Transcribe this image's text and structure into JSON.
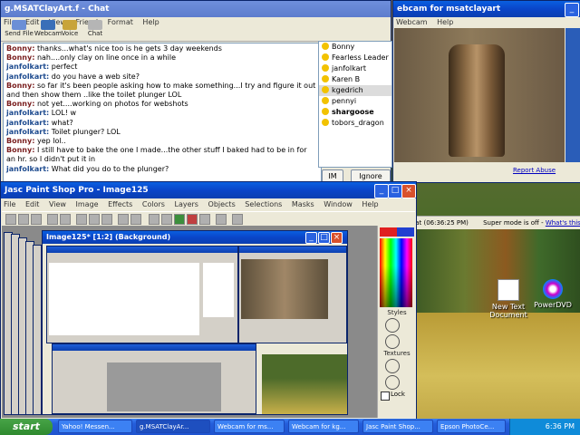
{
  "chat": {
    "title": "g.MSATClayArt.f - Chat",
    "menu": [
      "File",
      "Edit",
      "View",
      "Friend",
      "Format",
      "Help"
    ],
    "toolbar": [
      "Send File",
      "Webcam",
      "Voice",
      "Chat"
    ],
    "messages": [
      {
        "who": "Bonny:",
        "text": "thanks...what's nice too is he gets 3 day weekends"
      },
      {
        "who": "Bonny:",
        "text": "nah....only clay on line once in a while"
      },
      {
        "who": "janfolkart:",
        "text": "perfect"
      },
      {
        "who": "janfolkart:",
        "text": "do you have a web site?"
      },
      {
        "who": "Bonny:",
        "text": "so far it's been people asking how to make something...I try and figure it out and then show them ..like the toilet plunger LOL"
      },
      {
        "who": "Bonny:",
        "text": "not yet....working on photos for webshots"
      },
      {
        "who": "janfolkart:",
        "text": "LOL! w"
      },
      {
        "who": "janfolkart:",
        "text": "what?"
      },
      {
        "who": "janfolkart:",
        "text": "Toilet plunger? LOL"
      },
      {
        "who": "Bonny:",
        "text": "yep lol.."
      },
      {
        "who": "Bonny:",
        "text": "I still have to bake the one I made...the other stuff I baked had to be in for an hr. so I didn't put it in"
      },
      {
        "who": "janfolkart:",
        "text": "What did you do to the plunger?"
      }
    ],
    "users": [
      "Bonny",
      "Fearless Leader",
      "janfolkart",
      "Karen B",
      "kgedrich",
      "pennyi",
      "shargoose",
      "tobors_dragon"
    ],
    "im_label": "IM",
    "ignore_label": "Ignore User"
  },
  "webcam": {
    "title": "ebcam for msatclayart",
    "menu": [
      "Webcam",
      "Help"
    ],
    "report": "Report Abuse",
    "info_received": "ceived at (06:36:25 PM)",
    "super_mode": "Super mode is off -",
    "whats_this": "What's this?"
  },
  "psp": {
    "title": "Jasc Paint Shop Pro - Image125",
    "menu": [
      "File",
      "Edit",
      "View",
      "Image",
      "Effects",
      "Colors",
      "Layers",
      "Objects",
      "Selections",
      "Masks",
      "Window",
      "Help"
    ],
    "image_title": "Image125* [1:2] (Background)",
    "palette_labels": [
      "Styles",
      "Textures"
    ],
    "lock_label": "Lock"
  },
  "desktop": {
    "icons": [
      "New Text Document",
      "PowerDVD"
    ]
  },
  "taskbar": {
    "start": "start",
    "tasks": [
      "Yahoo! Messen...",
      "g.MSATClayAr...",
      "Webcam for ms...",
      "Webcam for kg...",
      "Jasc Paint Shop...",
      "Epson PhotoCe..."
    ],
    "clock": "6:36 PM"
  }
}
